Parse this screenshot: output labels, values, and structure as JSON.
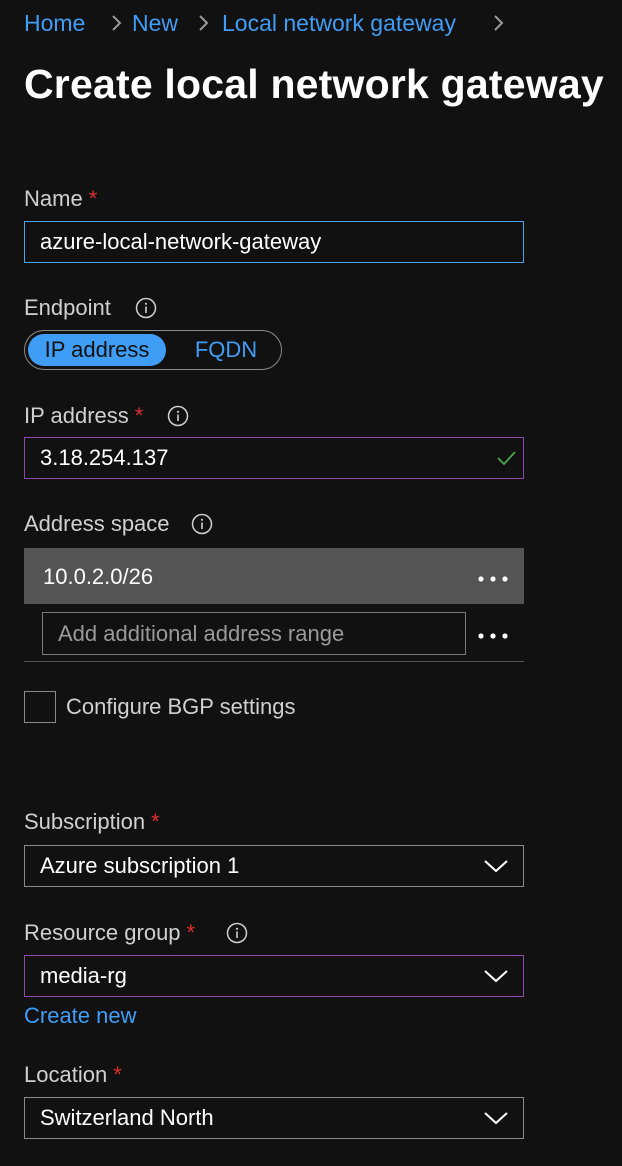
{
  "breadcrumb": {
    "items": [
      "Home",
      "New",
      "Local network gateway"
    ]
  },
  "page": {
    "title": "Create local network gateway"
  },
  "form": {
    "name": {
      "label": "Name",
      "required_mark": "*",
      "value": "azure-local-network-gateway"
    },
    "endpoint": {
      "label": "Endpoint",
      "options": [
        "IP address",
        "FQDN"
      ],
      "selected": "IP address"
    },
    "ip_address": {
      "label": "IP address",
      "required_mark": "*",
      "value": "3.18.254.137"
    },
    "address_space": {
      "label": "Address space",
      "entries": [
        "10.0.2.0/26"
      ],
      "placeholder": "Add additional address range"
    },
    "bgp": {
      "label": "Configure BGP settings",
      "checked": false
    },
    "subscription": {
      "label": "Subscription",
      "required_mark": "*",
      "value": "Azure subscription 1"
    },
    "resource_group": {
      "label": "Resource group",
      "required_mark": "*",
      "value": "media-rg",
      "create_new": "Create new"
    },
    "location": {
      "label": "Location",
      "required_mark": "*",
      "value": "Switzerland North"
    }
  },
  "icons": {
    "info": "info-icon",
    "chevron_right": "chevron-right-icon",
    "chevron_down": "chevron-down-icon",
    "check": "checkmark-icon",
    "more": "more-options-icon"
  },
  "colors": {
    "background": "#111111",
    "link": "#3f9df5",
    "required": "#e0302f",
    "valid": "#4aa84a",
    "focus_border": "#8c4aa8",
    "selected_row": "#545454"
  }
}
